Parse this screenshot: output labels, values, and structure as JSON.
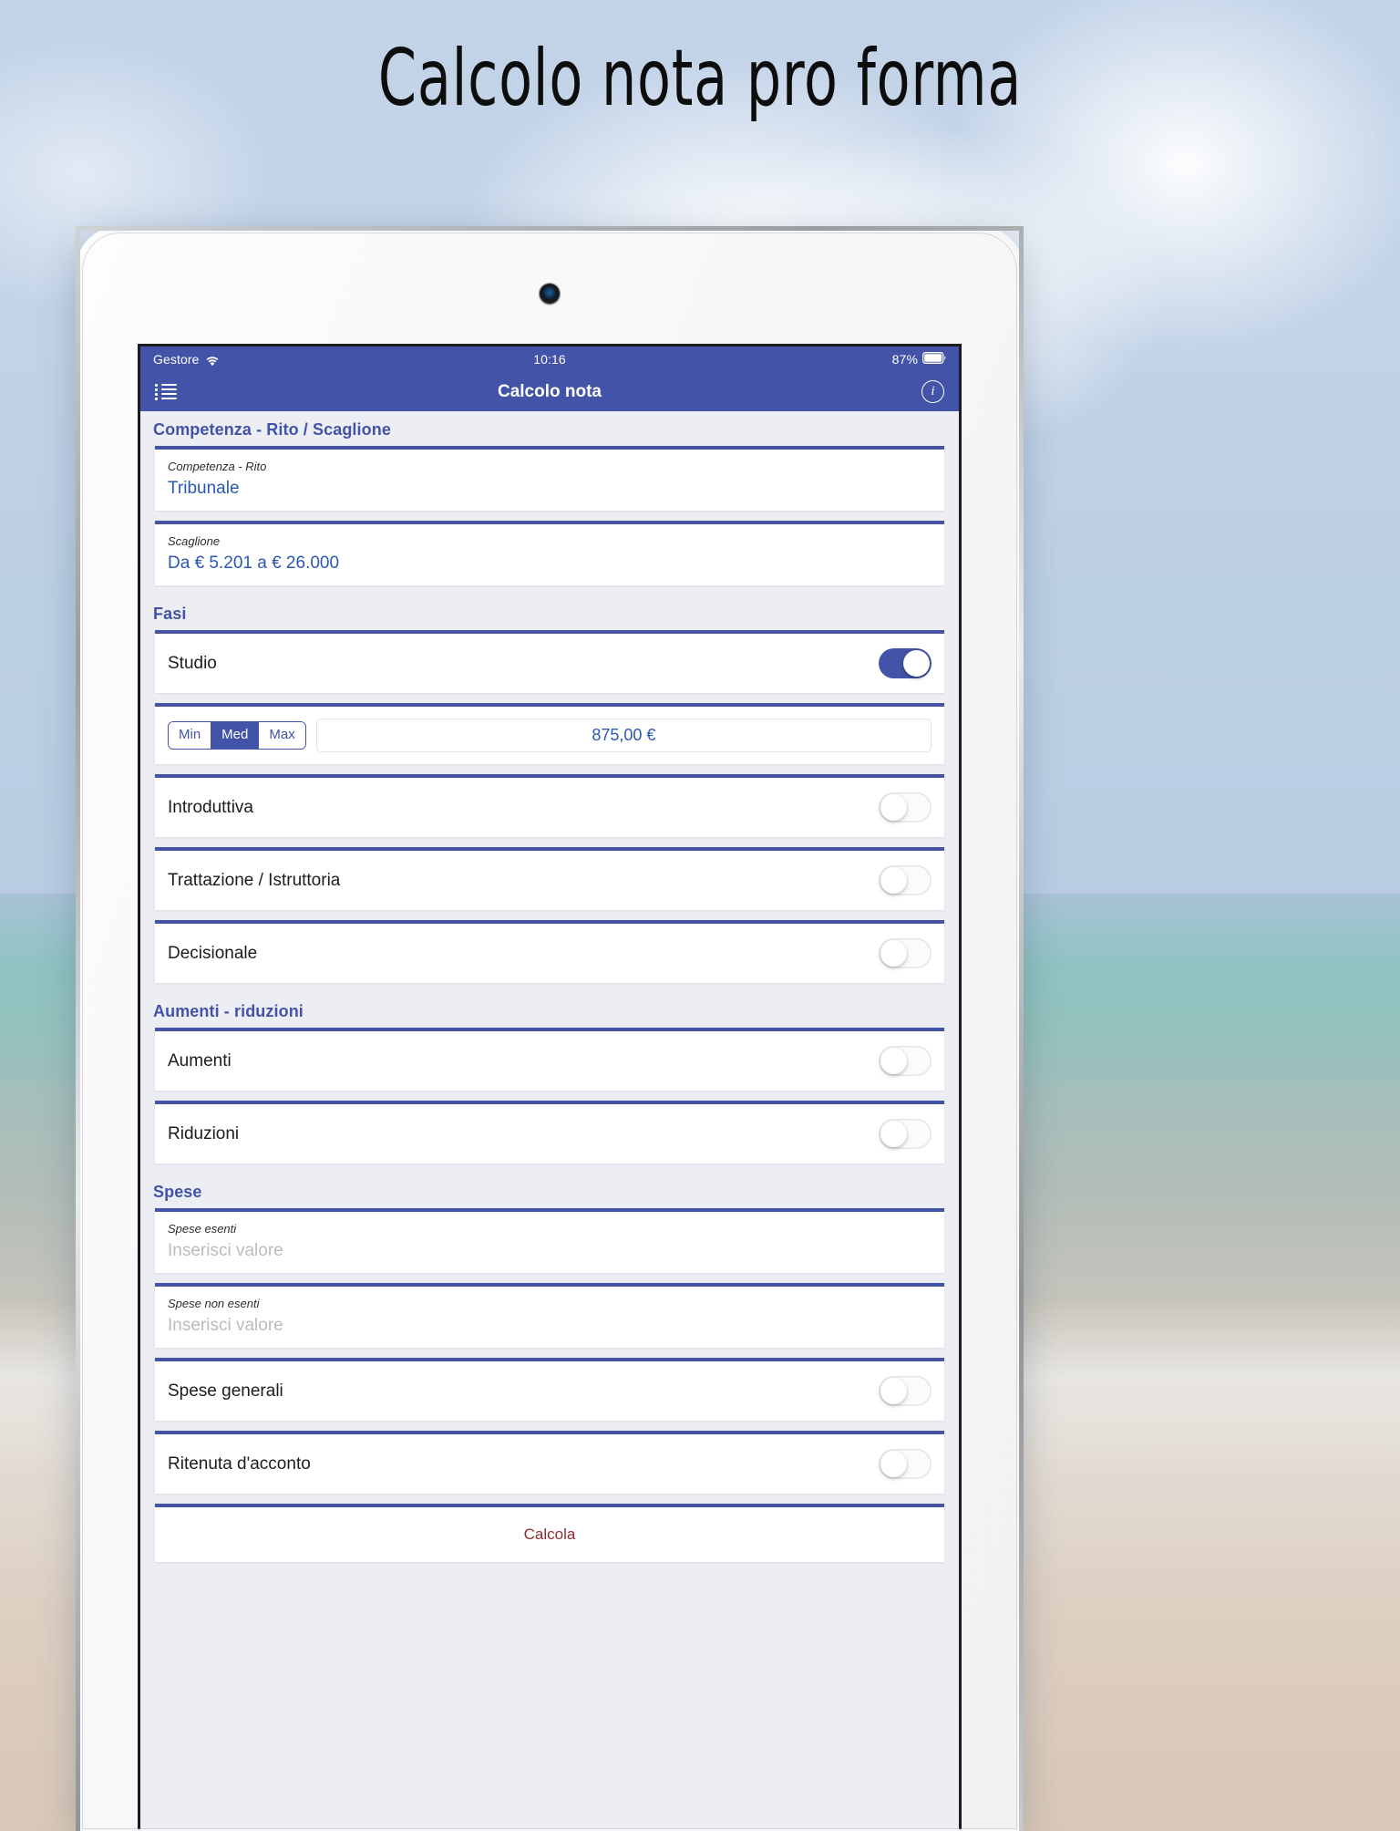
{
  "page": {
    "title": "Calcolo nota pro forma"
  },
  "status_bar": {
    "carrier": "Gestore",
    "wifi_icon": "wifi-icon",
    "time": "10:16",
    "battery_percent": "87%",
    "battery_icon": "battery-icon"
  },
  "nav_bar": {
    "menu_icon": "list-menu-icon",
    "title": "Calcolo nota",
    "info_icon": "info-circle-icon"
  },
  "sections": {
    "competenza": {
      "header": "Competenza - Rito / Scaglione",
      "fields": [
        {
          "label": "Competenza - Rito",
          "value": "Tribunale"
        },
        {
          "label": "Scaglione",
          "value": "Da € 5.201 a € 26.000"
        }
      ]
    },
    "fasi": {
      "header": "Fasi",
      "rows": [
        {
          "label": "Studio",
          "toggle": "on"
        },
        {
          "label": "Introduttiva",
          "toggle": "off"
        },
        {
          "label": "Trattazione / Istruttoria",
          "toggle": "off"
        },
        {
          "label": "Decisionale",
          "toggle": "off"
        }
      ],
      "segmented": {
        "options": [
          "Min",
          "Med",
          "Max"
        ],
        "selected": "Med",
        "amount": "875,00 €"
      }
    },
    "aumenti": {
      "header": "Aumenti - riduzioni",
      "rows": [
        {
          "label": "Aumenti",
          "toggle": "off"
        },
        {
          "label": "Riduzioni",
          "toggle": "off"
        }
      ]
    },
    "spese": {
      "header": "Spese",
      "inputs": [
        {
          "label": "Spese esenti",
          "placeholder": "Inserisci valore",
          "value": ""
        },
        {
          "label": "Spese non esenti",
          "placeholder": "Inserisci valore",
          "value": ""
        }
      ],
      "rows": [
        {
          "label": "Spese generali",
          "toggle": "off"
        },
        {
          "label": "Ritenuta d'acconto",
          "toggle": "off"
        }
      ]
    }
  },
  "actions": {
    "calculate_label": "Calcola"
  },
  "colors": {
    "accent_blue": "#4253a8",
    "value_blue": "#2a58b5",
    "action_red": "#8c2b30",
    "app_background": "#eceef4"
  }
}
